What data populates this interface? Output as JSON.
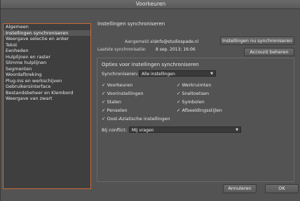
{
  "window": {
    "title": "Voorkeuren"
  },
  "sidebar": {
    "items": [
      {
        "label": "Algemeen"
      },
      {
        "label": "Instellingen synchroniseren"
      },
      {
        "label": "Weergave selectie en anker"
      },
      {
        "label": "Tekst"
      },
      {
        "label": "Eenheden"
      },
      {
        "label": "Hulplijnen en raster"
      },
      {
        "label": "Slimme hulplijnen"
      },
      {
        "label": "Segmenten"
      },
      {
        "label": "Woordafbreking"
      },
      {
        "label": "Plug-ins en werkschijven"
      },
      {
        "label": "Gebruikersinterface"
      },
      {
        "label": "Bestandsbeheer en Klembord"
      },
      {
        "label": "Weergave van zwart"
      }
    ],
    "selected_index": 1
  },
  "main": {
    "section_title": "Instellingen synchroniseren",
    "signed_in_label": "Aangemeld als:",
    "signed_in_value": "info@studiospade.nl",
    "last_sync_label": "Laatste synchronisatie:",
    "last_sync_value": "8 sep. 2013; 16:06",
    "sync_now_button": "Instellingen nu synchroniseren",
    "manage_account_button": "Account beheren",
    "options_title": "Opties voor instellingen synchroniseren",
    "sync_label": "Synchroniseren:",
    "sync_value": "Alle instellingen",
    "checkboxes": [
      {
        "label": "Voorkeuren",
        "checked": true
      },
      {
        "label": "Werkruimten",
        "checked": true
      },
      {
        "label": "Voorinstellingen",
        "checked": true
      },
      {
        "label": "Sneltoetsen",
        "checked": true
      },
      {
        "label": "Stalen",
        "checked": true
      },
      {
        "label": "Symbolen",
        "checked": true
      },
      {
        "label": "Penselen",
        "checked": true
      },
      {
        "label": "Afbeeldingsstijlen",
        "checked": true
      },
      {
        "label": "Oost-Aziatische instellingen",
        "checked": true
      }
    ],
    "conflict_label": "Bij conflict:",
    "conflict_value": "Mij vragen"
  },
  "footer": {
    "cancel_button": "Annuleren",
    "ok_button": "OK"
  },
  "colors": {
    "dialog_bg": "#535353",
    "sidebar_bg": "#3f3f3f",
    "accent_border": "#c86a3a",
    "desktop_bg": "#e8d7a8"
  },
  "icons": {
    "check": "checkmark-icon",
    "dropdown": "chevron-down-icon"
  }
}
